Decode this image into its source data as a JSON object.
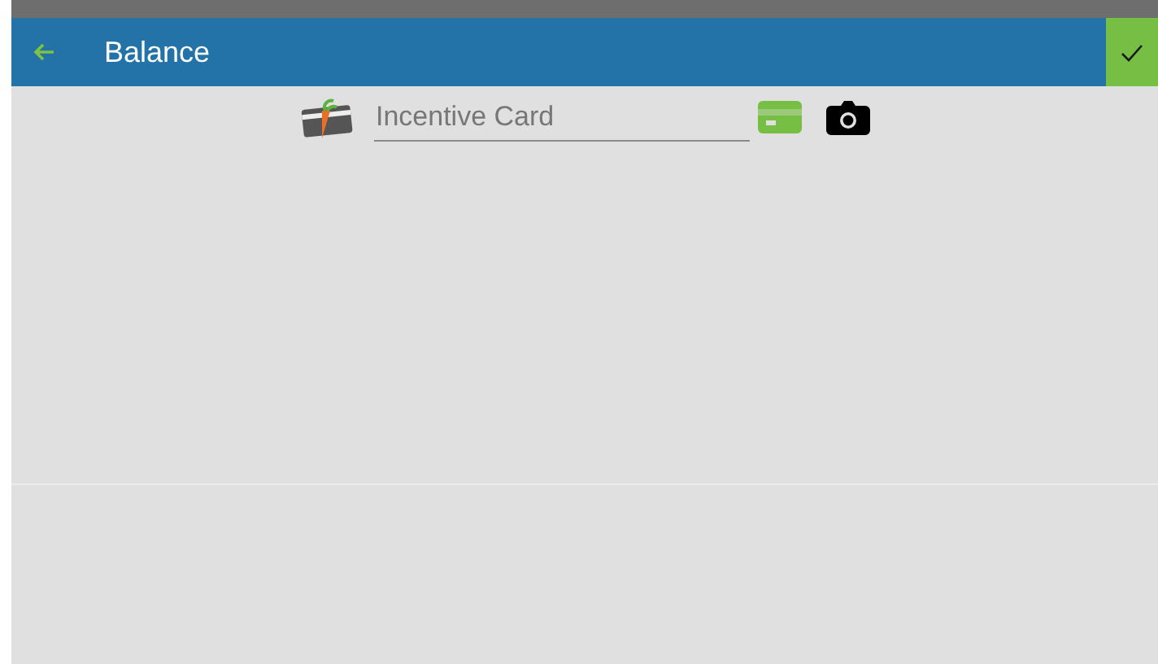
{
  "app_bar": {
    "title": "Balance"
  },
  "card_field": {
    "placeholder": "Incentive Card"
  }
}
